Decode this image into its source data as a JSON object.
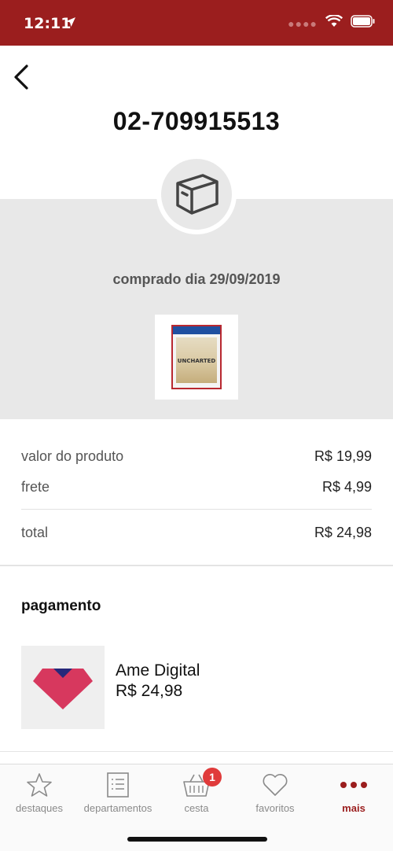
{
  "status_bar": {
    "time": "12:11"
  },
  "header": {
    "order_number": "02-709915513"
  },
  "order": {
    "purchase_date": "comprado dia 29/09/2019",
    "product_cover_title": "UNCHARTED"
  },
  "summary": {
    "product_label": "valor do produto",
    "product_value": "R$ 19,99",
    "shipping_label": "frete",
    "shipping_value": "R$ 4,99",
    "total_label": "total",
    "total_value": "R$ 24,98"
  },
  "payment": {
    "title": "pagamento",
    "method": "Ame Digital",
    "amount": "R$ 24,98"
  },
  "tab_bar": {
    "tabs": [
      {
        "label": "destaques",
        "icon": "star-icon"
      },
      {
        "label": "departamentos",
        "icon": "list-icon"
      },
      {
        "label": "cesta",
        "icon": "basket-icon",
        "badge": "1"
      },
      {
        "label": "favoritos",
        "icon": "heart-icon"
      },
      {
        "label": "mais",
        "icon": "more-icon"
      }
    ]
  },
  "colors": {
    "brand": "#9b1e1e",
    "panel": "#e8e8e8",
    "badge": "#e03b3b",
    "ame": "#d7385e"
  }
}
